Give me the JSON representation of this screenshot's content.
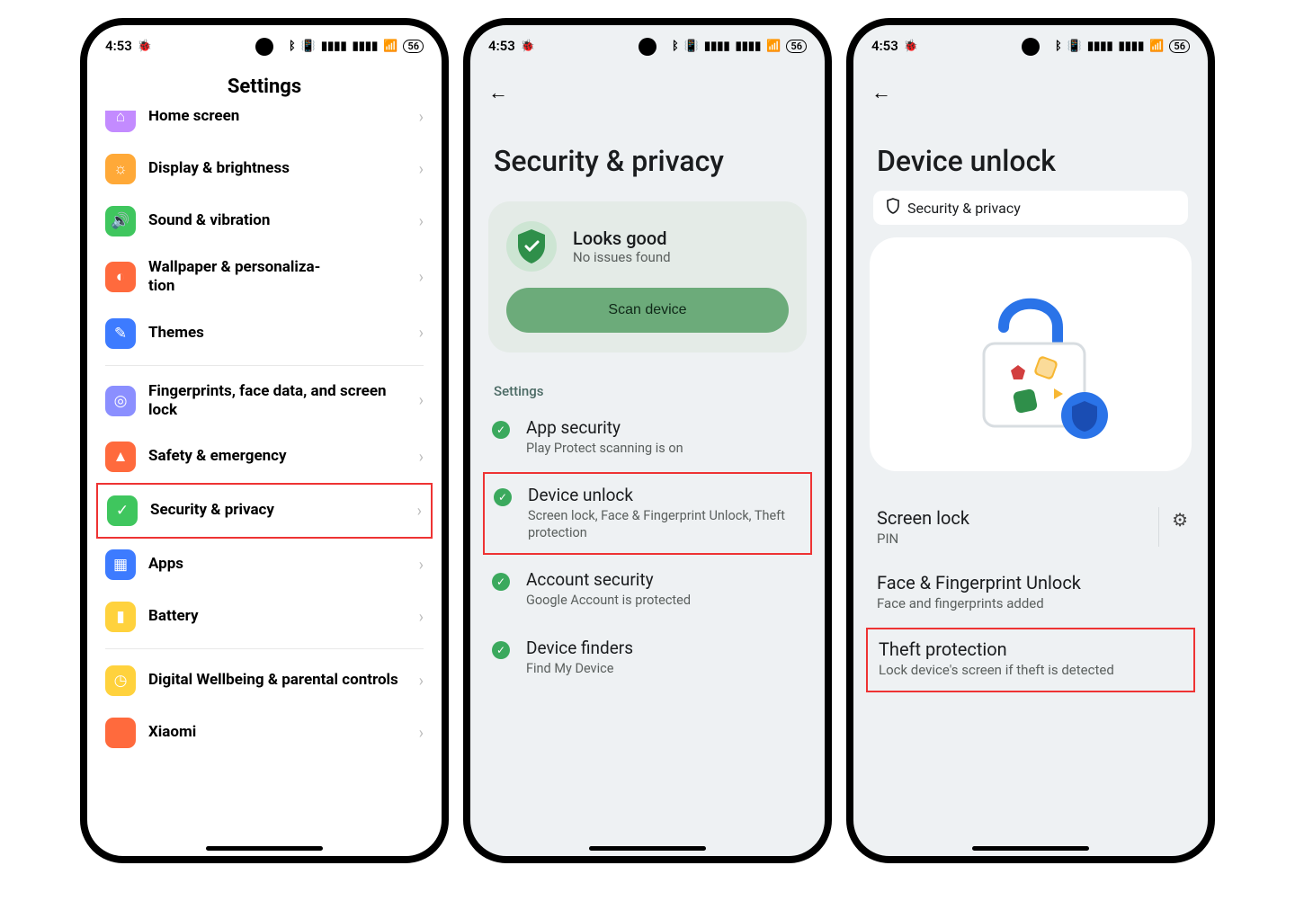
{
  "status": {
    "time": "4:53",
    "battery": "56"
  },
  "phone1": {
    "title": "Settings",
    "items": [
      {
        "label": "Home screen",
        "icon": "⌂",
        "color": "#c38bff"
      },
      {
        "label": "Display & brightness",
        "icon": "☼",
        "color": "#ffa938"
      },
      {
        "label": "Sound & vibration",
        "icon": "🔊",
        "color": "#3fc65e"
      },
      {
        "label": "Wallpaper & personaliza-\ntion",
        "icon": "◐",
        "color": "#ff6a3d"
      },
      {
        "label": "Themes",
        "icon": "✎",
        "color": "#3d7bff"
      }
    ],
    "items2": [
      {
        "label": "Fingerprints, face data, and screen lock",
        "icon": "◎",
        "color": "#8b8fff"
      },
      {
        "label": "Safety & emergency",
        "icon": "⛑",
        "color": "#ff6a3d"
      }
    ],
    "highlighted": {
      "label": "Security & privacy",
      "icon": "✓",
      "color": "#3fc65e"
    },
    "items3": [
      {
        "label": "Apps",
        "icon": "▦",
        "color": "#3d7bff"
      },
      {
        "label": "Battery",
        "icon": "▮",
        "color": "#ffd23d"
      }
    ],
    "items4": [
      {
        "label": "Digital Wellbeing & parental controls",
        "icon": "◷",
        "color": "#ffd23d"
      },
      {
        "label": "Xiaomi",
        "icon": "",
        "color": "#ff6a3d"
      }
    ]
  },
  "phone2": {
    "title": "Security & privacy",
    "card": {
      "title": "Looks good",
      "sub": "No issues found",
      "button": "Scan device"
    },
    "section": "Settings",
    "items": [
      {
        "title": "App security",
        "sub": "Play Protect scanning is on"
      }
    ],
    "highlighted": {
      "title": "Device unlock",
      "sub": "Screen lock, Face & Fingerprint Unlock, Theft protection"
    },
    "items_after": [
      {
        "title": "Account security",
        "sub": "Google Account is protected"
      },
      {
        "title": "Device finders",
        "sub": "Find My Device"
      }
    ]
  },
  "phone3": {
    "title": "Device unlock",
    "chip": "Security & privacy",
    "rows": [
      {
        "title": "Screen lock",
        "sub": "PIN",
        "gear": true
      },
      {
        "title": "Face & Fingerprint Unlock",
        "sub": "Face and fingerprints added"
      }
    ],
    "highlighted": {
      "title": "Theft protection",
      "sub": "Lock device's screen if theft is detected"
    }
  }
}
